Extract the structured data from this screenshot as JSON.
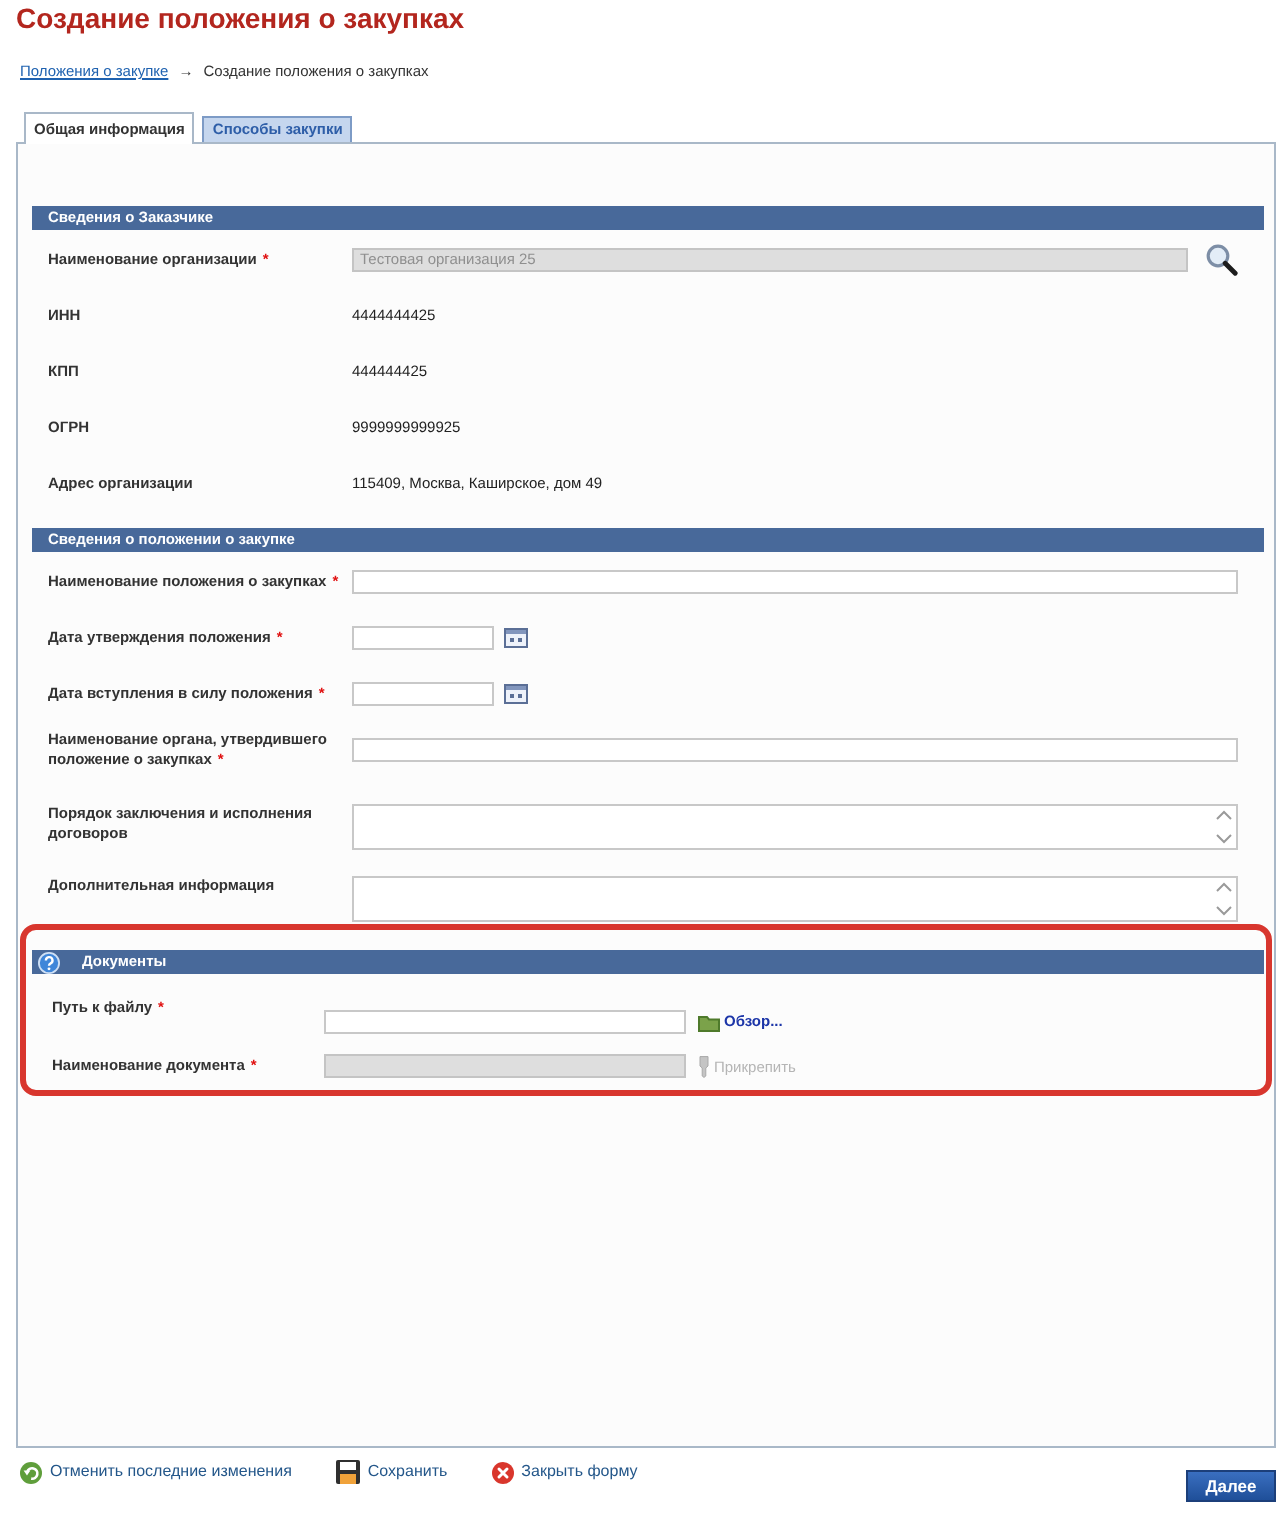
{
  "page": {
    "title": "Создание положения о закупках"
  },
  "breadcrumb": {
    "link": "Положения о закупке",
    "separator": "→",
    "current": "Создание положения о закупках"
  },
  "tabs": [
    {
      "label": "Общая информация",
      "selected": true
    },
    {
      "label": "Способы закупки",
      "selected": false
    }
  ],
  "sections": [
    {
      "title": "Сведения о Заказчике",
      "rows": [
        {
          "kind": "lookup",
          "label": "Наименование организации",
          "required_mark": "*",
          "value": "Тестовая организация 25",
          "disabled": true
        },
        {
          "kind": "text",
          "label": "ИНН",
          "value": "4444444425"
        },
        {
          "kind": "text",
          "label": "КПП",
          "value": "444444425"
        },
        {
          "kind": "text",
          "label": "ОГРН",
          "value": "9999999999925"
        },
        {
          "kind": "text",
          "label": "Адрес организации",
          "value": "115409, Москва, Каширское, дом 49"
        }
      ]
    },
    {
      "title": "Сведения о положении о закупке",
      "rows": [
        {
          "kind": "input",
          "label": "Наименование положения о закупках",
          "required_mark": "*",
          "disabled": false
        },
        {
          "kind": "date",
          "label": "Дата утверждения положения",
          "required_mark": "*",
          "disabled": false
        },
        {
          "kind": "date",
          "label": "Дата вступления в силу положения",
          "required_mark": "*",
          "disabled": false
        },
        {
          "kind": "input",
          "label": "Наименование органа, утвердившего положение о закупках",
          "required_mark": "*",
          "disabled": false
        },
        {
          "kind": "textarea",
          "label": "Порядок заключения и исполнения договоров",
          "disabled": false
        },
        {
          "kind": "textarea",
          "label": "Дополнительная информация",
          "disabled": false
        }
      ]
    },
    {
      "title": "Документы",
      "help_icon": true,
      "highlighted": true,
      "rows": [
        {
          "kind": "file",
          "label": "Путь к файлу",
          "required_mark": "*",
          "disabled": false,
          "action": {
            "label": "Обзор...",
            "disabled": false
          }
        },
        {
          "kind": "attach",
          "label": "Наименование документа",
          "required_mark": "*",
          "disabled": true,
          "action": {
            "label": "Прикрепить",
            "disabled": true
          }
        }
      ]
    }
  ],
  "footer": {
    "actions": [
      {
        "kind": "undo",
        "label": "Отменить последние изменения"
      },
      {
        "kind": "save",
        "label": "Сохранить"
      },
      {
        "kind": "close",
        "label": "Закрыть форму"
      }
    ],
    "next_button": "Далее"
  }
}
